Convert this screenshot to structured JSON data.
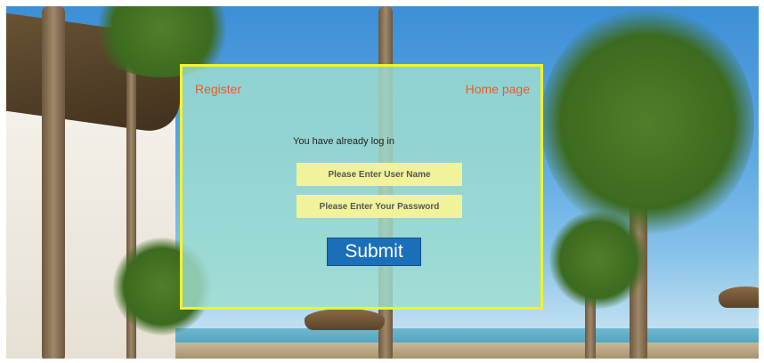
{
  "panel": {
    "register_link": "Register",
    "home_link": "Home page",
    "status_text": "You have already log in",
    "username_placeholder": "Please Enter User Name",
    "password_placeholder": "Please Enter Your Password",
    "submit_label": "Submit"
  },
  "colors": {
    "panel_border": "#f2f22a",
    "link": "#ee5a2c",
    "input_bg": "#f1f39b",
    "submit_bg": "#1b6fb9"
  }
}
